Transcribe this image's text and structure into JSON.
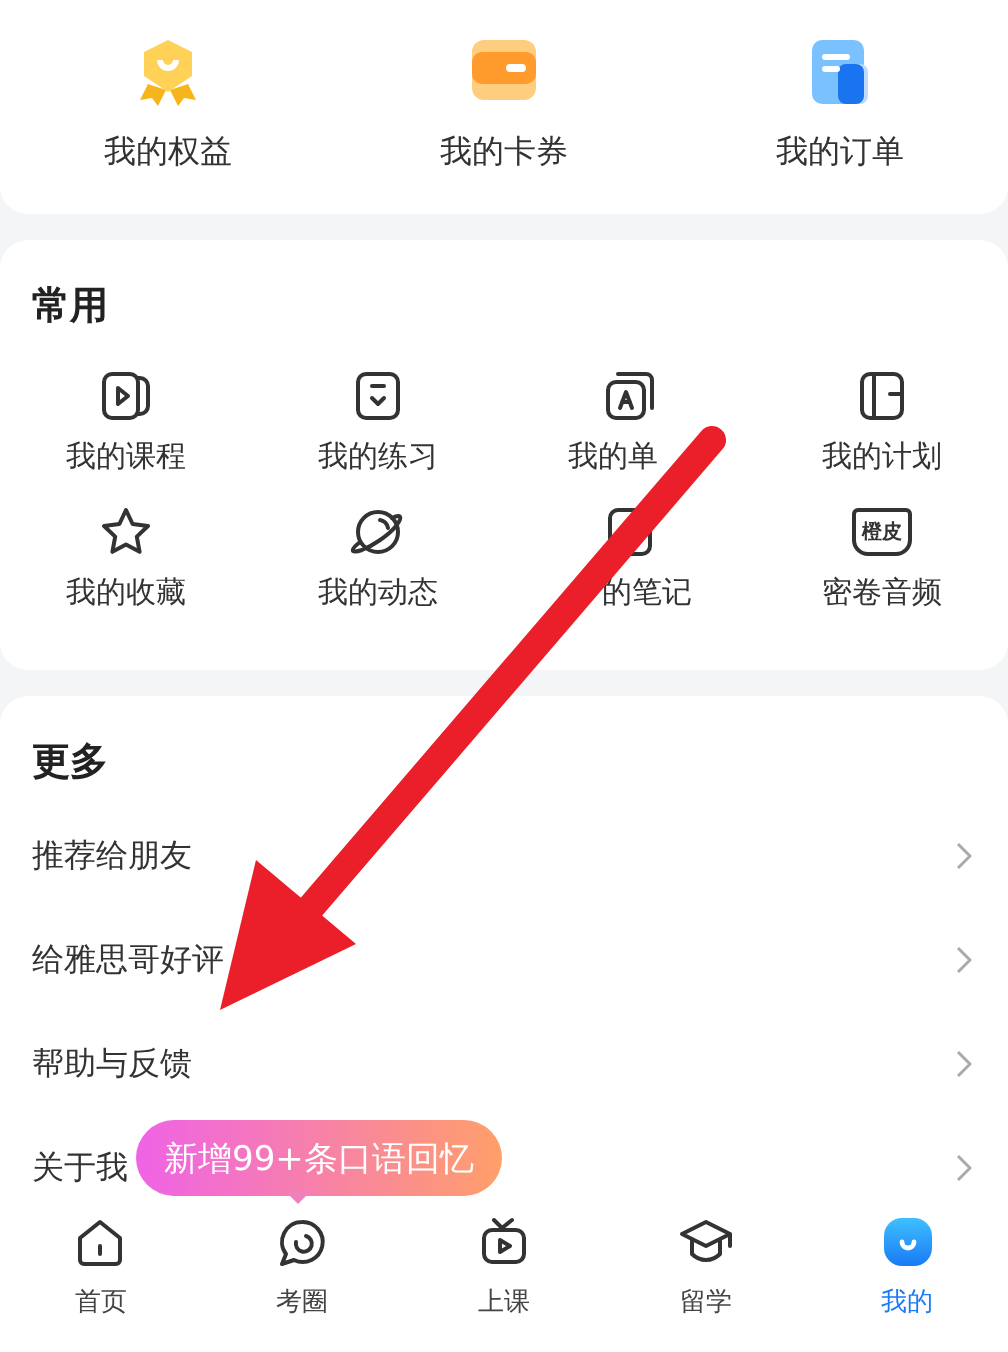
{
  "benefits": [
    {
      "label": "我的权益",
      "kind": "medal"
    },
    {
      "label": "我的卡券",
      "kind": "card"
    },
    {
      "label": "我的订单",
      "kind": "order"
    }
  ],
  "common": {
    "title": "常用",
    "items": [
      {
        "label": "我的课程",
        "kind": "course"
      },
      {
        "label": "我的练习",
        "kind": "practice"
      },
      {
        "label": "我的单",
        "kind": "words"
      },
      {
        "label": "我的计划",
        "kind": "plan"
      },
      {
        "label": "我的收藏",
        "kind": "star"
      },
      {
        "label": "我的动态",
        "kind": "planet"
      },
      {
        "label": "的笔记",
        "kind": "note"
      },
      {
        "label": "密卷音频",
        "kind": "book",
        "icon_text": "橙皮"
      }
    ]
  },
  "more": {
    "title": "更多",
    "items": [
      {
        "label": "推荐给朋友"
      },
      {
        "label": "给雅思哥好评"
      },
      {
        "label": "帮助与反馈"
      },
      {
        "label": "关于我"
      }
    ]
  },
  "bubble": "新增99+条口语回忆",
  "tabs": [
    {
      "label": "首页",
      "kind": "home",
      "selected": false
    },
    {
      "label": "考圈",
      "kind": "circle",
      "selected": false
    },
    {
      "label": "上课",
      "kind": "tv",
      "selected": false
    },
    {
      "label": "留学",
      "kind": "cap",
      "selected": false
    },
    {
      "label": "我的",
      "kind": "me",
      "selected": true
    }
  ]
}
